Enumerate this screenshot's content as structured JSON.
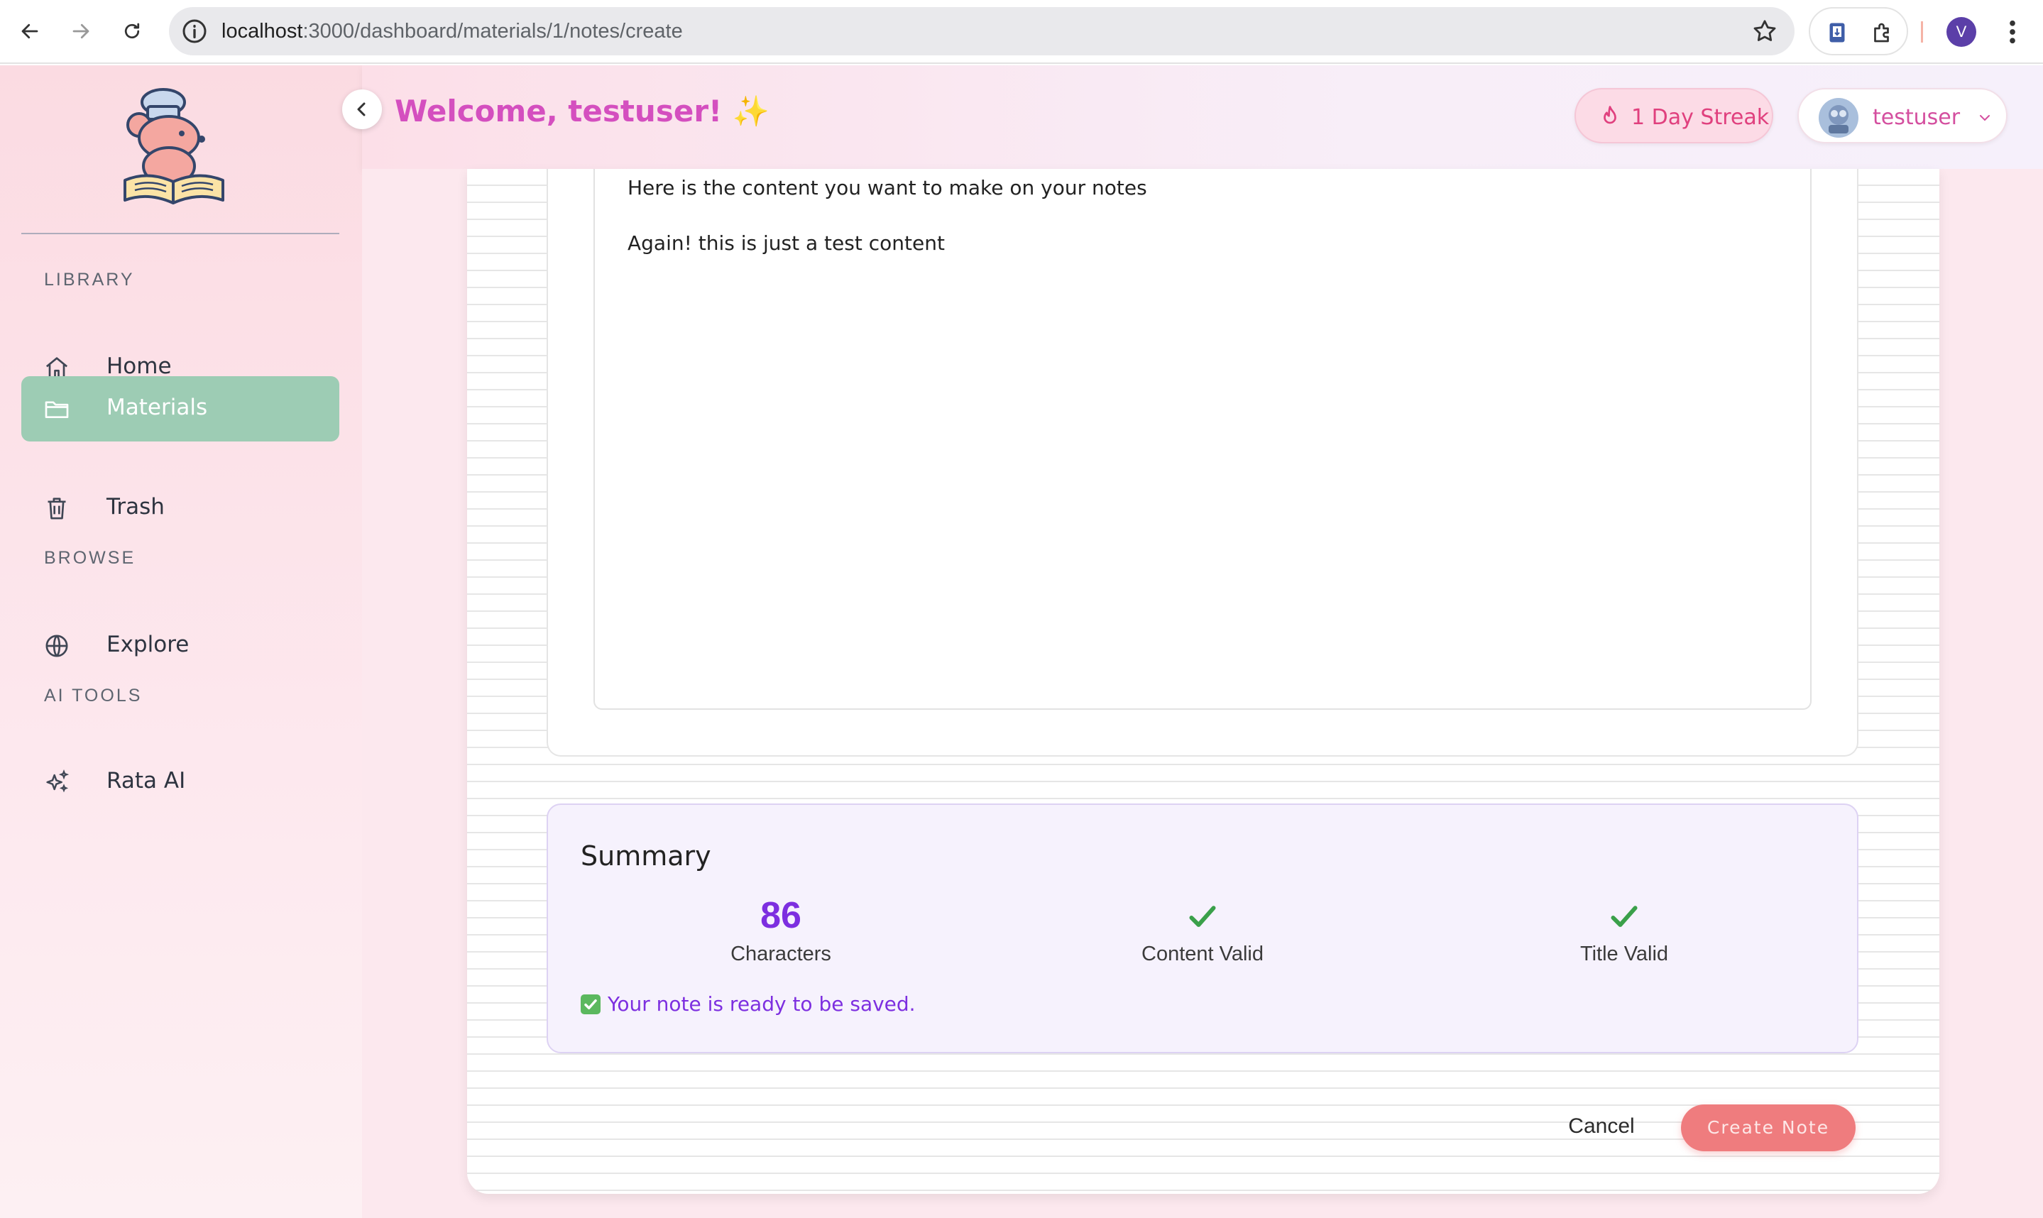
{
  "browser": {
    "url_host": "localhost",
    "url_path": ":3000/dashboard/materials/1/notes/create",
    "profile_initial": "V"
  },
  "sidebar": {
    "sections": [
      {
        "label": "LIBRARY"
      },
      {
        "label": "BROWSE"
      },
      {
        "label": "AI TOOLS"
      }
    ],
    "items": [
      {
        "label": "Home",
        "icon": "home-icon"
      },
      {
        "label": "Materials",
        "icon": "folder-icon",
        "active": true
      },
      {
        "label": "Trash",
        "icon": "trash-icon"
      },
      {
        "label": "Explore",
        "icon": "globe-icon"
      },
      {
        "label": "Rata AI",
        "icon": "sparkles-icon"
      }
    ]
  },
  "header": {
    "welcome": "Welcome, testuser! ✨",
    "streak": "1 Day Streak",
    "username": "testuser"
  },
  "editor": {
    "lines": [
      "Here is the content you want to make on your notes",
      "Again! this is just a test content"
    ]
  },
  "summary": {
    "title": "Summary",
    "characters_value": "86",
    "characters_label": "Characters",
    "content_label": "Content Valid",
    "title_label": "Title Valid",
    "ready_message": "Your note is ready to be saved."
  },
  "actions": {
    "cancel": "Cancel",
    "create": "Create Note"
  },
  "colors": {
    "accent_purple": "#7d2fe0",
    "welcome_pink": "#d44fbf",
    "active_green": "#9dccb4",
    "create_button": "#ef7c7e",
    "check_green": "#3aa04a"
  }
}
